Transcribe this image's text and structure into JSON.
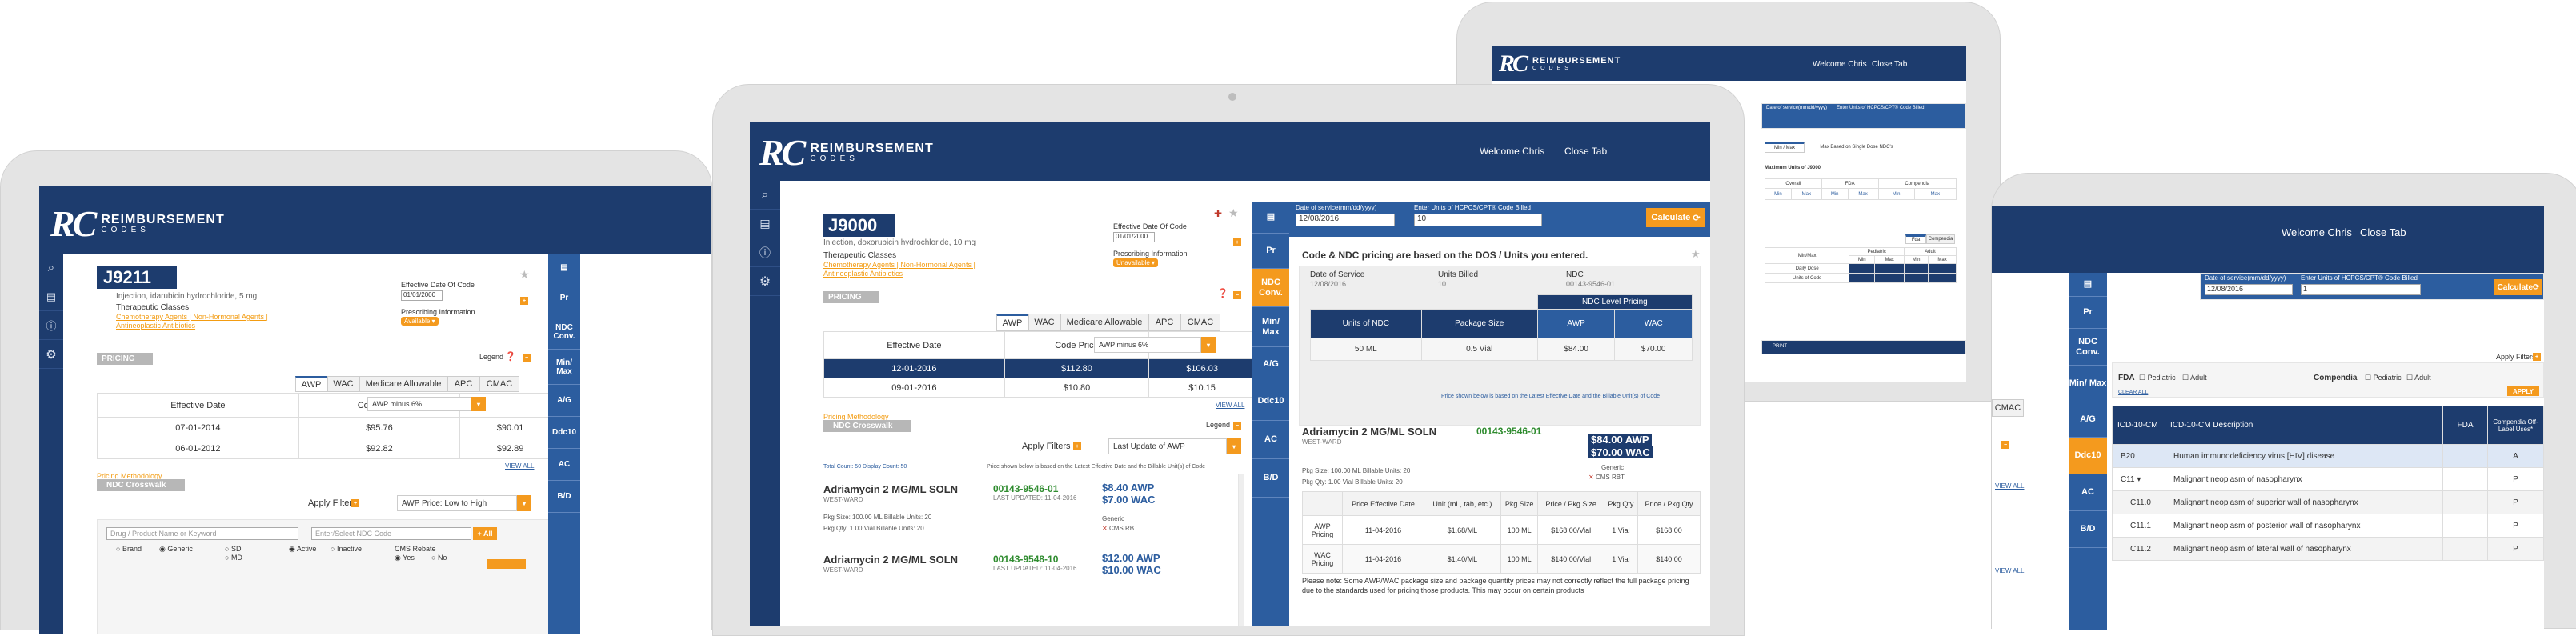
{
  "brand": {
    "rc": "RC",
    "line1": "REIMBURSEMENT",
    "line2": "CODES"
  },
  "header": {
    "welcome": "Welcome Chris",
    "close_tab": "Close Tab"
  },
  "nav_icons": [
    "search-icon",
    "calendar-icon",
    "info-icon",
    "gear-icon"
  ],
  "right_nav": {
    "s1": [
      "Pr",
      "NDC Conv.",
      "Min/ Max",
      "A/G",
      "Ddc10",
      "AC",
      "B/D"
    ],
    "s2": [
      "Pr",
      "NDC Conv.",
      "Min/ Max",
      "A/G",
      "Ddc10",
      "AC",
      "B/D"
    ],
    "s4": [
      "Pr",
      "NDC Conv.",
      "Min/ Max",
      "A/G",
      "Ddc10",
      "AC",
      "B/D"
    ]
  },
  "s1": {
    "code": "J9211",
    "desc": "Injection, idarubicin hydrochloride, 5 mg",
    "therapeutic_label": "Therapeutic Classes",
    "therapeutic_values": [
      "Chemotherapy Agents | Non-Hormonal Agents |",
      "Antineoplastic Antibiotics"
    ],
    "eff_label": "Effective Date Of Code",
    "eff_value": "01/01/2000",
    "presc_label": "Prescribing Information",
    "presc_badge": "Available ▾",
    "pricing": "PRICING",
    "legend": "Legend",
    "tabs": [
      "AWP",
      "WAC",
      "Medicare Allowable",
      "APC",
      "CMAC"
    ],
    "col_eff": "Effective Date",
    "col_price": "Code Price",
    "select": "AWP minus 6%",
    "rows": [
      [
        "07-01-2014",
        "$95.76",
        "$90.01"
      ],
      [
        "06-01-2012",
        "$92.82",
        "$92.89"
      ]
    ],
    "view_all": "VIEW ALL",
    "pricing_method": "Pricing Methodology",
    "crosswalk": "NDC Crosswalk",
    "apply_filters": "Apply Filters",
    "sort": "AWP Price: Low to High",
    "search_ph": "Drug / Product Name or Keyword",
    "ndc_ph": "Enter/Select NDC Code",
    "all": "+ All",
    "radios": [
      "Brand",
      "Generic",
      "SD",
      "Active",
      "Inactive",
      "MD"
    ],
    "cms_label": "CMS Rebate",
    "cms_opts": [
      "Yes",
      "No"
    ]
  },
  "s2": {
    "code": "J9000",
    "desc": "Injection, doxorubicin hydrochloride, 10 mg",
    "therapeutic_label": "Therapeutic Classes",
    "therapeutic_values": [
      "Chemotherapy Agents | Non-Hormonal Agents |",
      "Antineoplastic Antibiotics"
    ],
    "eff_label": "Effective Date Of Code",
    "eff_value": "01/01/2000",
    "presc_label": "Prescribing Information",
    "presc_badge": "Unavailable ▾",
    "pricing": "PRICING",
    "legend": "Legend",
    "tabs": [
      "AWP",
      "WAC",
      "Medicare Allowable",
      "APC",
      "CMAC"
    ],
    "col_eff": "Effective Date",
    "col_price": "Code Price",
    "select": "AWP minus 6%",
    "rows": [
      [
        "12-01-2016",
        "$112.80",
        "$106.03"
      ],
      [
        "09-01-2016",
        "$10.80",
        "$10.15"
      ]
    ],
    "view_all": "VIEW ALL",
    "pricing_method": "Pricing Methodology",
    "crosswalk": "NDC Crosswalk",
    "apply_filters": "Apply Filters",
    "sort": "Last Update of AWP",
    "total": "Total Count: 50  Display Count: 50",
    "price_note": "Price shown below is based on the Latest Effective Date and the Billable Unit(s) of Code",
    "drugs": [
      {
        "name": "Adriamycin 2 MG/ML SOLN",
        "mfr": "WEST-WARD",
        "ndc": "00143-9546-01",
        "upd": "LAST UPDATED: 11-04-2016",
        "awp": "$8.40 AWP",
        "wac": "$7.00 WAC",
        "size": "Pkg Size: 100.00 ML  Billable Units: 20",
        "qty": "Pkg Qty: 1.00 Vial  Billable Units: 20",
        "gen": "Generic",
        "cms": "CMS RBT"
      },
      {
        "name": "Adriamycin 2 MG/ML SOLN",
        "mfr": "WEST-WARD",
        "ndc": "00143-9548-10",
        "upd": "LAST UPDATED: 11-04-2016",
        "awp": "$12.00 AWP",
        "wac": "$10.00 WAC",
        "size": "",
        "qty": "",
        "gen": "",
        "cms": ""
      }
    ],
    "dos_label": "Date of service(mm/dd/yyyy)",
    "dos_value": "12/08/2016",
    "units_label": "Enter Units of HCPCS/CPT® Code Billed",
    "units_value": "10",
    "calc": "Calculate",
    "ndc_title": "Code & NDC pricing are based on the DOS / Units you entered.",
    "sum_labels": [
      "Date of Service",
      "Units Billed",
      "NDC"
    ],
    "sum_values": [
      "12/08/2016",
      "10",
      "00143-9546-01"
    ],
    "level_title": "NDC Level Pricing",
    "grid_heads": [
      "Units of NDC",
      "Package Size",
      "AWP",
      "WAC"
    ],
    "grid_vals": [
      "50 ML",
      "0.5 Vial",
      "$84.00",
      "$70.00"
    ],
    "grid_note": "Price shown below is based on the Latest Effective Date and the Billable Unit(s) of Code",
    "drug_name": "Adriamycin 2 MG/ML SOLN",
    "drug_ndc": "00143-9546-01",
    "drug_mfr": "WEST-WARD",
    "drug_awp": "$84.00 AWP",
    "drug_wac": "$70.00 WAC",
    "drug_gen": "Generic",
    "drug_cms": "CMS RBT",
    "drug_size": "Pkg Size: 100.00 ML  Billable Units: 20",
    "drug_qty": "Pkg Qty: 1.00 Vial  Billable Units: 20",
    "price_heads": [
      "Price Effective Date",
      "Unit (mL, tab, etc.)",
      "Pkg Size",
      "Price / Pkg Size",
      "Pkg Qty",
      "Price / Pkg Qty"
    ],
    "awp_row": [
      "AWP Pricing",
      "11-04-2016",
      "$1.68/ML",
      "100 ML",
      "$168.00/Vial",
      "1 Vial",
      "$168.00"
    ],
    "wac_row": [
      "WAC Pricing",
      "11-04-2016",
      "$1.40/ML",
      "100 ML",
      "$140.00/Vial",
      "1 Vial",
      "$140.00"
    ],
    "note": "Please note: Some AWP/WAC package size and package quantity prices may not correctly reflect the full package pricing due to the standards used for pricing those products. This may occur on certain products"
  },
  "s3": {
    "welcome": "Welcome Chris",
    "close_tab": "Close Tab",
    "dos_label": "Date of service(mm/dd/yyyy)",
    "units_label": "Enter Units of HCPCS/CPT® Code Billed",
    "tabs": [
      "Min / Max",
      "Max Based on Single Dose NDC's"
    ],
    "sub": "Maximum Units of J9000",
    "cols": [
      "Overall",
      "FDA",
      "Compendia"
    ],
    "min": "Min",
    "max": "Max",
    "tab2": [
      "Fda",
      "Compendia"
    ],
    "ped_heads": [
      "Pediatric",
      "Adult"
    ],
    "minmax": "Min/Max",
    "rows": [
      "Daily Dose",
      "Units of Code"
    ],
    "print": "PRINT"
  },
  "s4": {
    "welcome": "Welcome Chris",
    "close_tab": "Close Tab",
    "dos_label": "Date of service(mm/dd/yyyy)",
    "dos_value": "12/08/2016",
    "units_label": "Enter Units of HCPCS/CPT® Code Billed",
    "units_value": "1",
    "calc": "Calculate",
    "apply_filters": "Apply Filters",
    "fda": "FDA",
    "ped": "Pediatric",
    "adult": "Adult",
    "comp": "Compendia",
    "apply": "APPLY",
    "clear": "CLEAR ALL",
    "cmac": "CMAC",
    "view_all": "VIEW ALL",
    "heads": [
      "ICD-10-CM",
      "ICD-10-CM Description",
      "FDA",
      "Compendia Off-Label Uses*"
    ],
    "rows": [
      [
        "B20",
        "Human immunodeficiency virus [HIV] disease",
        "",
        "A"
      ],
      [
        "C11 ▾",
        "Malignant neoplasm of nasopharynx",
        "",
        "P"
      ],
      [
        "C11.0",
        "Malignant neoplasm of superior wall of nasopharynx",
        "",
        "P"
      ],
      [
        "C11.1",
        "Malignant neoplasm of posterior wall of nasopharynx",
        "",
        "P"
      ],
      [
        "C11.2",
        "Malignant neoplasm of lateral wall of nasopharynx",
        "",
        "P"
      ]
    ]
  }
}
